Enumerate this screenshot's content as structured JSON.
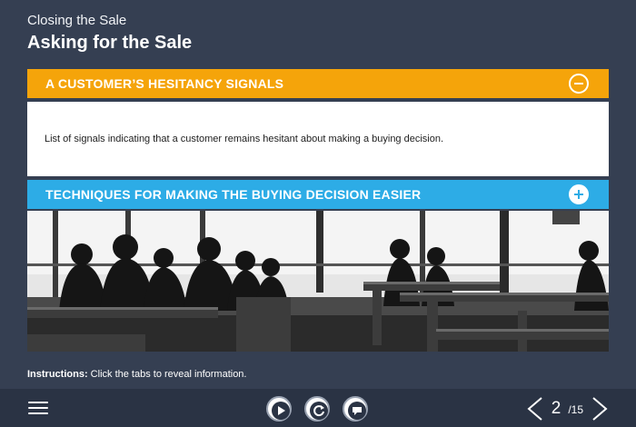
{
  "header": {
    "subtitle": "Closing the Sale",
    "title": "Asking for the Sale"
  },
  "accordion": {
    "sections": [
      {
        "label": "A CUSTOMER’S HESITANCY SIGNALS",
        "state": "expanded",
        "color": "#f5a40a",
        "icon": "minus-circle-icon",
        "body": "List of signals indicating that a customer remains hesitant about making a buying decision."
      },
      {
        "label": "TECHNIQUES FOR MAKING THE BUYING DECISION EASIER",
        "state": "collapsed",
        "color": "#2dace6",
        "icon": "plus-circle-icon"
      }
    ]
  },
  "instructions": {
    "prefix": "Instructions:",
    "text": " Click the tabs to reveal information."
  },
  "footer": {
    "menu_icon": "hamburger-menu-icon",
    "controls": [
      "play-icon",
      "replay-icon",
      "comment-icon"
    ],
    "page_current": "2",
    "page_total": "/15"
  }
}
